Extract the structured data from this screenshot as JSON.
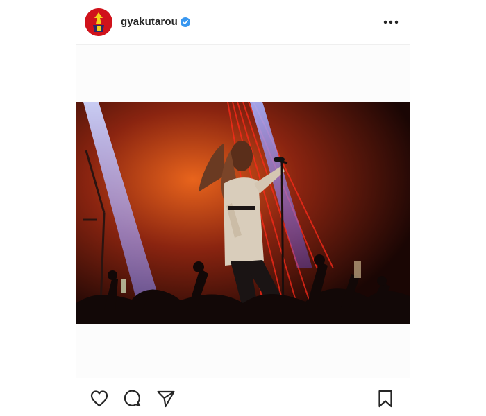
{
  "header": {
    "username": "gyakutarou",
    "verified": true,
    "avatar_icon": "avatar-logo",
    "more_icon": "more-options-icon"
  },
  "post": {
    "media_type": "photo",
    "media_subject": "live concert"
  },
  "actions": {
    "like_icon": "heart-icon",
    "comment_icon": "comment-icon",
    "share_icon": "send-icon",
    "save_icon": "bookmark-icon"
  },
  "colors": {
    "verified_badge": "#3897f0",
    "avatar_bg": "#d0121b",
    "divider": "#efefef",
    "text": "#262626"
  }
}
